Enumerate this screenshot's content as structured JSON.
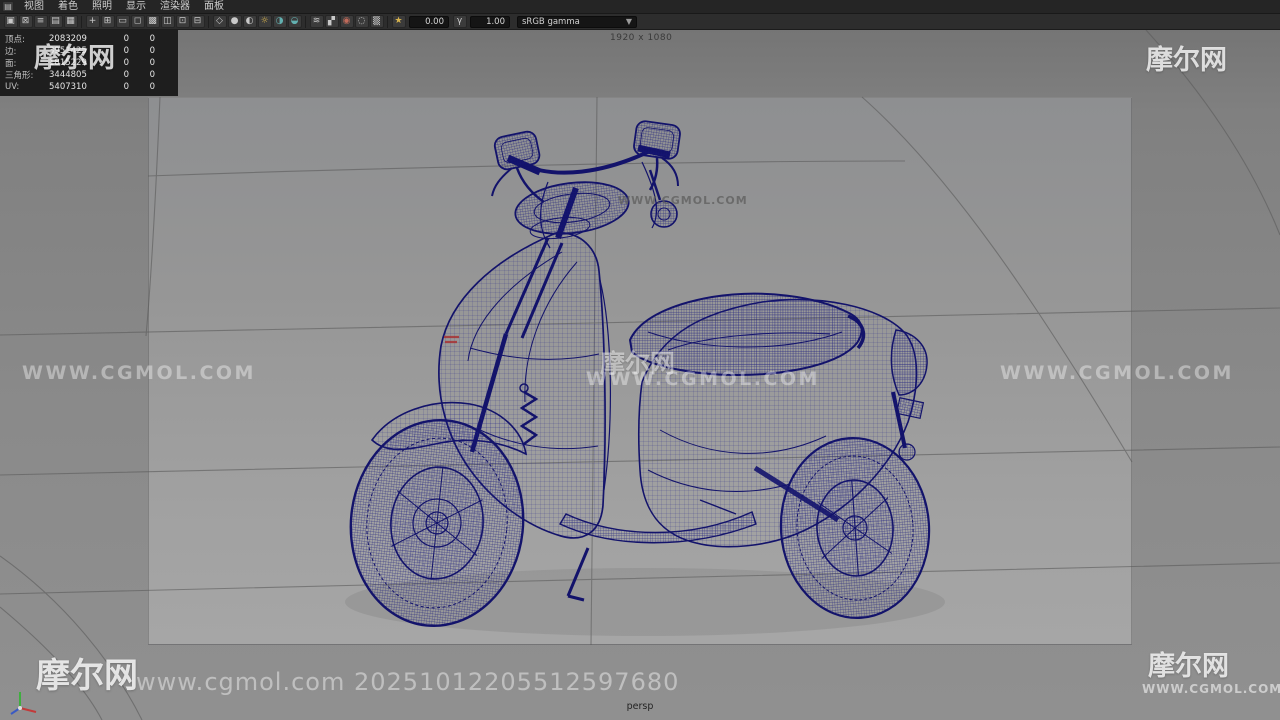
{
  "menubar": {
    "grip_glyph": "▤",
    "items": [
      {
        "label": "视图"
      },
      {
        "label": "着色"
      },
      {
        "label": "照明"
      },
      {
        "label": "显示"
      },
      {
        "label": "渲染器"
      },
      {
        "label": "面板"
      }
    ]
  },
  "toolbar": {
    "icons": [
      {
        "name": "select-camera",
        "glyph": "▣"
      },
      {
        "name": "lock-camera",
        "glyph": "⊠"
      },
      {
        "name": "camera-attributes",
        "glyph": "≡"
      },
      {
        "name": "bookmarks",
        "glyph": "▤"
      },
      {
        "name": "image-plane",
        "glyph": "▦"
      },
      {
        "name": "pan-zoom",
        "glyph": "+"
      },
      {
        "name": "grid",
        "glyph": "⊞"
      },
      {
        "name": "film-gate",
        "glyph": "▭"
      },
      {
        "name": "resolution-gate",
        "glyph": "◻"
      },
      {
        "name": "gate-mask",
        "glyph": "▩"
      },
      {
        "name": "field-chart",
        "glyph": "◫"
      },
      {
        "name": "safe-action",
        "glyph": "⊡"
      },
      {
        "name": "safe-title",
        "glyph": "⊟"
      },
      {
        "name": "wireframe",
        "glyph": "◇"
      },
      {
        "name": "shaded",
        "glyph": "●"
      },
      {
        "name": "textured",
        "glyph": "◐"
      },
      {
        "name": "lights",
        "glyph": "☼"
      },
      {
        "name": "shadows",
        "glyph": "◑"
      },
      {
        "name": "ambient-occlusion",
        "glyph": "◒"
      },
      {
        "name": "motion-blur",
        "glyph": "≋"
      },
      {
        "name": "anti-aliasing",
        "glyph": "▞"
      },
      {
        "name": "depth-of-field",
        "glyph": "◉"
      },
      {
        "name": "isolate-select",
        "glyph": "◌"
      },
      {
        "name": "xray",
        "glyph": "▒"
      },
      {
        "name": "exposure",
        "glyph": "★"
      },
      {
        "name": "gamma",
        "glyph": "γ"
      }
    ],
    "exposure_value": "0.00",
    "gamma_value": "1.00",
    "colorspace_value": "sRGB gamma",
    "colorspace_chevron": "▼"
  },
  "hud": {
    "stats": [
      {
        "label": "顶点:",
        "total": "2083209",
        "selected": "0",
        "component": "0"
      },
      {
        "label": "边:",
        "total": "3951425",
        "selected": "0",
        "component": "0"
      },
      {
        "label": "面:",
        "total": "1815229",
        "selected": "0",
        "component": "0"
      },
      {
        "label": "三角形:",
        "total": "3444805",
        "selected": "0",
        "component": "0"
      },
      {
        "label": "UV:",
        "total": "5407310",
        "selected": "0",
        "component": "0"
      }
    ],
    "resolution_gate": "1920 x 1080",
    "camera_name": "persp"
  },
  "watermarks": {
    "site": "WWW.CGMOL.COM",
    "brand": "摩尔网",
    "bottom_id": "www.cgmol.com 20251012205512597680"
  },
  "colors": {
    "wireframe": "#14146e",
    "viewport_bg": "#8f8f8f",
    "render_region_bg": "#9d9d9d",
    "toolbar_bg": "#2d2d2d",
    "hud_bg": "#1e1e1e"
  }
}
